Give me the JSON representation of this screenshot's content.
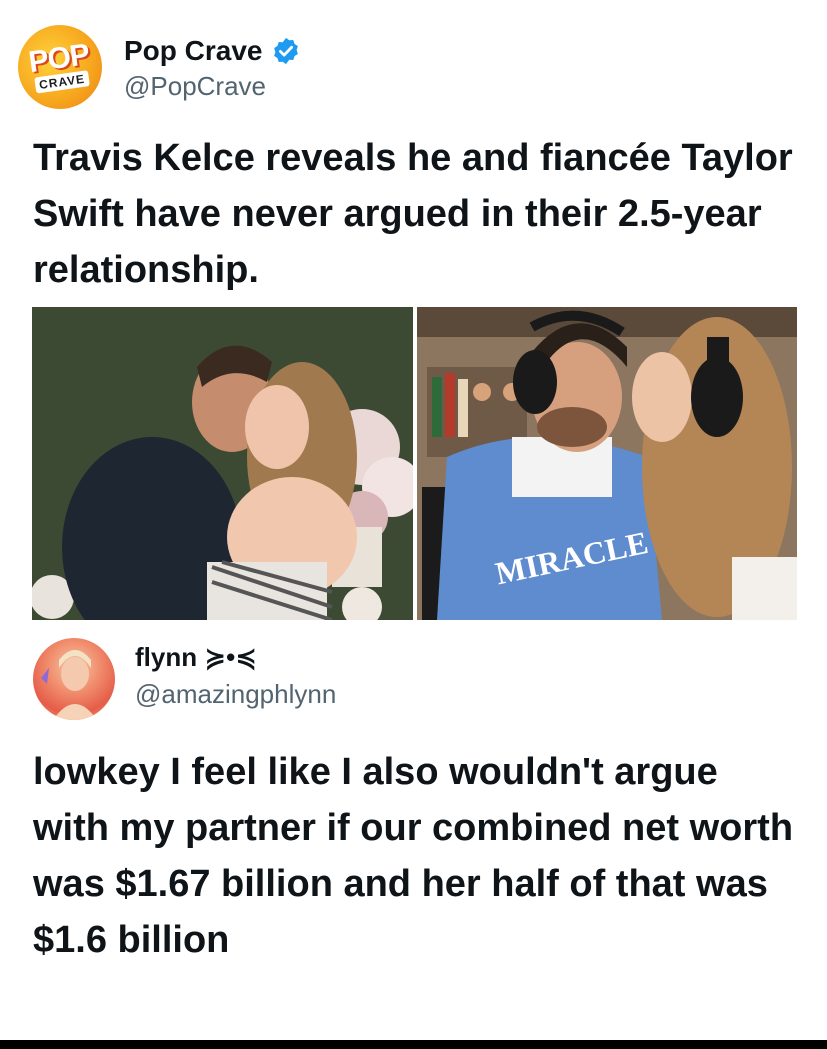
{
  "post": {
    "display_name": "Pop Crave",
    "handle": "@PopCrave",
    "avatar_logo_top": "POP",
    "avatar_logo_bottom": "CRAVE",
    "verified_icon": "verified-badge-icon",
    "text": "Travis Kelce reveals he and fiancée Taylor Swift have never argued in their 2.5-year relationship.",
    "images": [
      {
        "kind": "photo",
        "description_icon": "couple-embrace-photo"
      },
      {
        "kind": "photo",
        "description_icon": "couple-podcast-kiss-photo",
        "visible_text": "MIRACLE"
      }
    ]
  },
  "quote": {
    "display_name": "flynn ≽•≼",
    "handle": "@amazingphlynn",
    "text": "lowkey I feel like I also wouldn't argue with my partner if our combined net worth was $1.67 billion and her half of that was $1.6 billion"
  },
  "colors": {
    "text_primary": "#0f1419",
    "text_secondary": "#536471",
    "verified_blue": "#1d9bf0",
    "background": "#ffffff"
  }
}
